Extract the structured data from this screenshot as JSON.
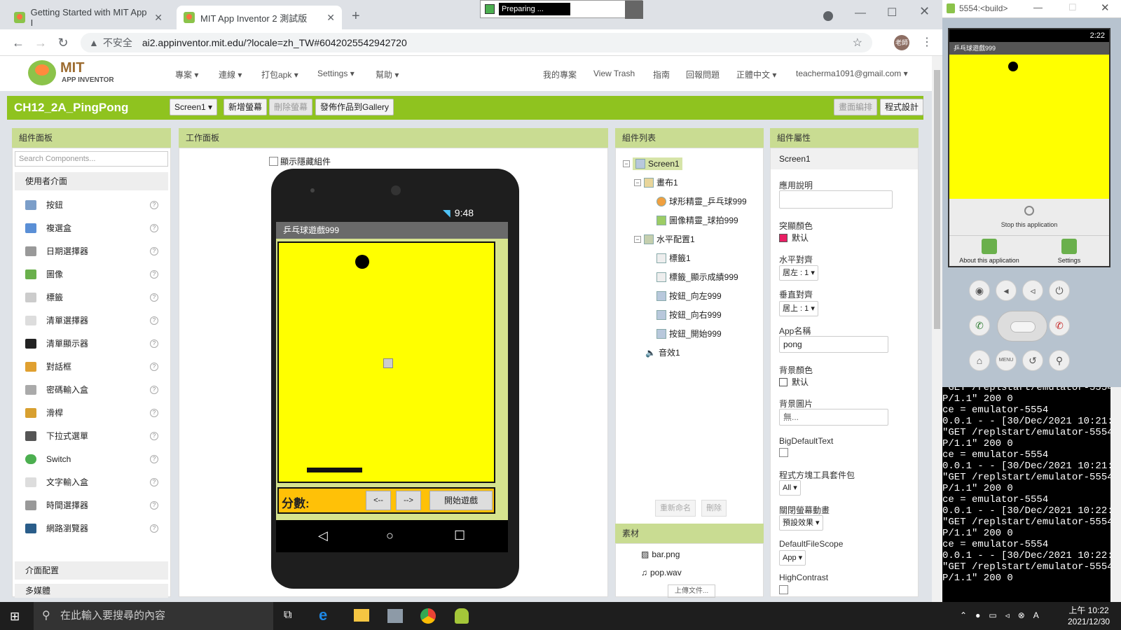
{
  "browser": {
    "tabs": [
      {
        "label": "Getting Started with MIT App I"
      },
      {
        "label": "MIT App Inventor 2 測試版"
      }
    ],
    "new_tab": "+",
    "insecure": "不安全",
    "url": "ai2.appinventor.mit.edu/?locale=zh_TW#6042025542942720",
    "profile": "老師",
    "preparing": "Preparing ..."
  },
  "header": {
    "logo_top": "MIT",
    "logo_bottom": "APP INVENTOR",
    "menus": [
      "專案",
      "連線",
      "打包apk",
      "Settings",
      "幫助"
    ],
    "right": [
      "我的專案",
      "View Trash",
      "指南",
      "回報問題",
      "正體中文",
      "teacherma1091@gmail.com"
    ]
  },
  "greenbar": {
    "project": "CH12_2A_PingPong",
    "screen_select": "Screen1",
    "add_screen": "新增螢幕",
    "remove_screen": "刪除螢幕",
    "publish": "發佈作品到Gallery",
    "designer": "畫面編排",
    "blocks": "程式設計"
  },
  "palette": {
    "title": "組件面板",
    "search_placeholder": "Search Components...",
    "section_ui": "使用者介面",
    "items": [
      "按鈕",
      "複選盒",
      "日期選擇器",
      "圖像",
      "標籤",
      "清單選擇器",
      "清單顯示器",
      "對話框",
      "密碼輸入盒",
      "滑桿",
      "下拉式選單",
      "Switch",
      "文字輸入盒",
      "時間選擇器",
      "網路瀏覽器"
    ],
    "section_layout": "介面配置",
    "section_media": "多媒體"
  },
  "viewer": {
    "title": "工作面板",
    "show_hidden": "顯示隱藏組件",
    "status_time": "9:48",
    "app_title": "乒乓球遊戲999",
    "score_label": "分數:",
    "left_btn": "<--",
    "right_btn": "-->",
    "start_btn": "開始遊戲"
  },
  "components": {
    "title": "組件列表",
    "tree": [
      {
        "label": "Screen1",
        "level": 0
      },
      {
        "label": "畫布1",
        "level": 1
      },
      {
        "label": "球形精靈_乒乓球999",
        "level": 2
      },
      {
        "label": "圖像精靈_球拍999",
        "level": 2
      },
      {
        "label": "水平配置1",
        "level": 1
      },
      {
        "label": "標籤1",
        "level": 2
      },
      {
        "label": "標籤_顯示成績999",
        "level": 2
      },
      {
        "label": "按鈕_向左999",
        "level": 2
      },
      {
        "label": "按鈕_向右999",
        "level": 2
      },
      {
        "label": "按鈕_開始999",
        "level": 2
      },
      {
        "label": "音效1",
        "level": 1
      }
    ],
    "rename": "重新命名",
    "delete": "刪除",
    "media_title": "素材",
    "media": [
      "bar.png",
      "pop.wav"
    ],
    "upload": "上傳文件..."
  },
  "properties": {
    "title": "組件屬性",
    "component": "Screen1",
    "about_label": "應用說明",
    "accent_label": "突顯顏色",
    "accent_value": "默认",
    "halign_label": "水平對齊",
    "halign_value": "居左 : 1",
    "valign_label": "垂直對齊",
    "valign_value": "居上 : 1",
    "appname_label": "App名稱",
    "appname_value": "pong",
    "bgcolor_label": "背景顏色",
    "bgcolor_value": "默认",
    "bgimage_label": "背景圖片",
    "bgimage_value": "無...",
    "bigtext_label": "BigDefaultText",
    "blocks_label": "程式方塊工具套件包",
    "blocks_value": "All",
    "anim_label": "關閉螢幕動畫",
    "anim_value": "預設效果",
    "scope_label": "DefaultFileScope",
    "scope_value": "App",
    "contrast_label": "HighContrast"
  },
  "emulator": {
    "title": "5554:<build>",
    "time": "2:22",
    "app_title": "乒乓球遊戲999",
    "stop": "Stop this application",
    "about": "About this application",
    "settings": "Settings",
    "menu": "MENU"
  },
  "log": "P/1.1\" 200 0\nce = emulator-5554\n0.0.1 - - [30/Dec/2021 10:21:\n\"GET /replstart/emulator-5554\nP/1.1\" 200 0\nce = emulator-5554\n0.0.1 - - [30/Dec/2021 10:21:\n\"GET /replstart/emulator-5554\nP/1.1\" 200 0\nce = emulator-5554\n0.0.1 - - [30/Dec/2021 10:22:\n\"GET /replstart/emulator-5554\nP/1.1\" 200 0\nce = emulator-5554\n0.0.1 - - [30/Dec/2021 10:22:\n\"GET /replstart/emulator-5554\nP/1.1\" 200 0",
  "log_top": "\"GET /replstart/emulator-5554",
  "taskbar": {
    "search": "在此輸入要搜尋的內容",
    "time": "上午 10:22",
    "date": "2021/12/30"
  },
  "colors": {
    "green": "#8fc31f",
    "panel_header": "#c9dc92",
    "canvas_yellow": "#ffff00",
    "accent_swatch": "#e91e63"
  }
}
